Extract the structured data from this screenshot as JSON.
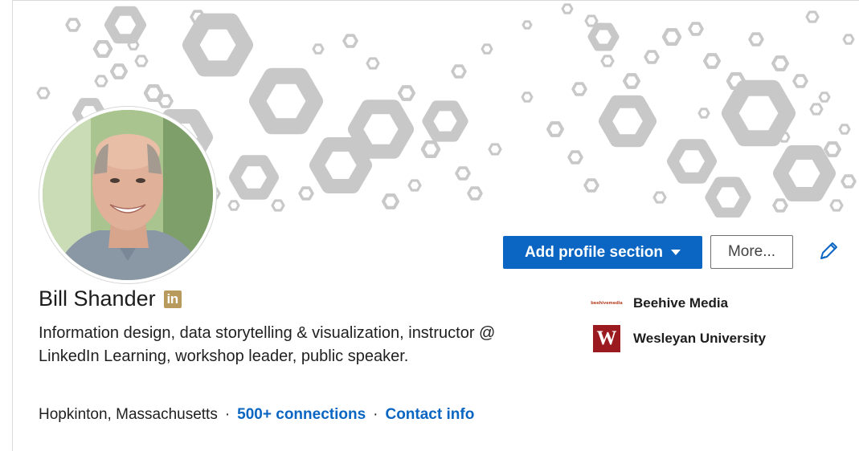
{
  "profile": {
    "name": "Bill Shander",
    "headline": "Information design, data storytelling & visualization, instructor @ LinkedIn Learning, workshop leader, public speaker.",
    "location": "Hopkinton, Massachusetts",
    "separator": "·",
    "connections": "500+ connections",
    "contact_info": "Contact info",
    "badge": "in"
  },
  "actions": {
    "add_section": "Add profile section",
    "more": "More..."
  },
  "organizations": [
    {
      "name": "Beehive Media",
      "logo_text": "beehivemedia",
      "logo_color": "#b8472b"
    },
    {
      "name": "Wesleyan University",
      "logo_text": "W",
      "logo_color": "#9b1a1f"
    }
  ],
  "icons": {
    "edit": "pencil-icon",
    "dropdown": "caret-down-icon",
    "badge": "linkedin-premium-icon"
  },
  "colors": {
    "brand_blue": "#0a66c2",
    "badge_gold": "#b89a5c",
    "banner_hex": "#c8c8c8"
  }
}
